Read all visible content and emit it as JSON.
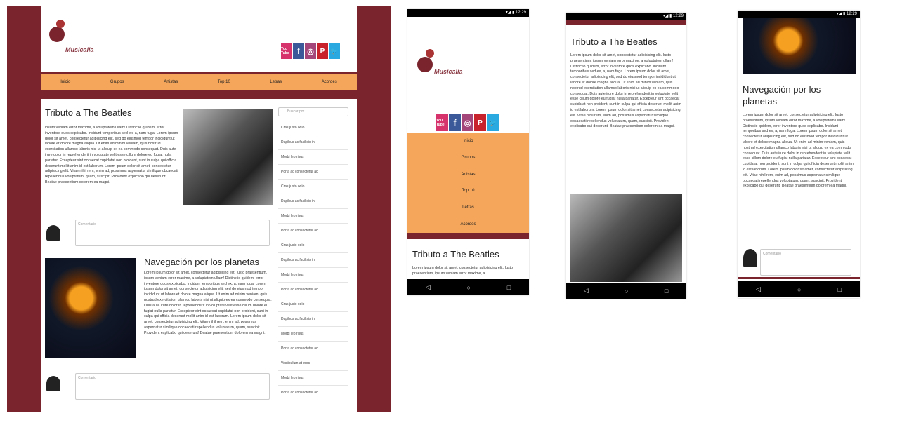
{
  "colors": {
    "brand": "#7a252e",
    "nav": "#f5a65b"
  },
  "brand": "Musicalia",
  "social": [
    {
      "icon": "youtube-icon",
      "label": "You Tube"
    },
    {
      "icon": "facebook-icon",
      "label": "f"
    },
    {
      "icon": "instagram-icon",
      "label": "◎"
    },
    {
      "icon": "pinterest-icon",
      "label": "P"
    },
    {
      "icon": "twitter-icon",
      "label": "🐦"
    }
  ],
  "nav": [
    "Inicio",
    "Grupos",
    "Artistas",
    "Top 10",
    "Letras",
    "Acordes"
  ],
  "posts": [
    {
      "title": "Tributo a The Beatles",
      "text": "ipsum veniam error maxime, a voluptatem ullam! Distinctio quidem, error inventore quos explicabo. Incidunt temporibus sed ex, a, nam fuga. Lorem ipsum dolor sit amet, consectetur adipisicing elit, sed do eiusmod tempor incididunt ut labore et dolore magna aliqua. Ut enim ad minim veniam, quis nostrud exercitation ullamco laboris nisi ut aliquip ex ea commodo consequat. Duis aute irure dolor in reprehenderit in voluptate velit esse cillum dolore eu fugiat nulla pariatur. Excepteur sint occaecat cupidatat non proident, sunt in culpa qui officia deserunt mollit anim id est laborum. Lorem ipsum dolor sit amet, consectetur adipisicing elit. Vitae nihil rem, enim ad, possimus aspernatur similique obcaecati repellendus voluptatum, quam, suscipit. Provident explicabo qui deserunt! Beatae praesentium dolorem ea magni.",
      "comment": "Comentario"
    },
    {
      "title": "Navegación por los planetas",
      "text": "Lorem ipsum dolor sit amet, consectetur adipisicing elit. Iusto praesentium, ipsum veniam error maxime, a voluptatem ullam! Distinctio quidem, error inventore quos explicabo. Incidunt temporibus sed ex, a, nam fuga. Lorem ipsum dolor sit amet, consectetur adipisicing elit, sed do eiusmod tempor incididunt ut labore et dolore magna aliqua. Ut enim ad minim veniam, quis nostrud exercitation ullamco laboris nisi ut aliquip ex ea commodo consequat. Duis aute irure dolor in reprehenderit in voluptate velit esse cillum dolore eu fugiat nulla pariatur. Excepteur sint occaecat cupidatat non proident, sunt in culpa qui officia deserunt mollit anim id est laborum. Lorem ipsum dolor sit amet, consectetur adipisicing elit. Vitae nihil rem, enim ad, possimus aspernatur similique obcaecati repellendus voluptatum, quam, suscipit. Provident explicabo qui deserunt! Beatae praesentium dolorem ea magni.",
      "comment": "Comentario"
    }
  ],
  "search_placeholder": "Buscar por...",
  "sidebar": [
    "Cras justo odio",
    "Dapibus ac facilisis in",
    "Morbi leo risus",
    "Porta ac consectetur ac",
    "Cras justo odio",
    "Dapibus ac facilisis in",
    "Morbi leo risus",
    "Porta ac consectetur ac",
    "Cras justo odio",
    "Dapibus ac facilisis in",
    "Morbi leo risus",
    "Porta ac consectetur ac",
    "Cras justo odio",
    "Dapibus ac facilisis in",
    "Morbi leo risus",
    "Porta ac consectetur ac",
    "Vestibulum at eros",
    "Morbi leo risus",
    "Porta ac consectetur ac"
  ],
  "phone": {
    "time": "12:29",
    "status_icons": "▾◢ ▮",
    "nav_back": "◁",
    "nav_home": "○",
    "nav_recent": "□"
  },
  "mobile": {
    "p1_title": "Tributo a The Beatles",
    "p1_text": "Lorem ipsum dolor sit amet, consectetur adipisicing elit. Iusto praesentium, ipsum veniam error maxime, a",
    "p2_title": "Tributo a The Beatles",
    "p2_text": "Lorem ipsum dolor sit amet, consectetur adipisicing elit. Iusto praesentium, ipsum veniam error maxime, a voluptatem ullam! Distinctio quidem, error inventore quos explicabo. Incidunt temporibus sed ex, a, nam fuga. Lorem ipsum dolor sit amet, consectetur adipisicing elit, sed do eiusmod tempor incididunt ut labore et dolore magna aliqua. Ut enim ad minim veniam, quis nostrud exercitation ullamco laboris nisi ut aliquip ex ea commodo consequat. Duis aute irure dolor in reprehenderit in voluptate velit esse cillum dolore eu fugiat nulla pariatur. Excepteur sint occaecat cupidatat non proident, sunt in culpa qui officia deserunt mollit anim id est laborum. Lorem ipsum dolor sit amet, consectetur adipisicing elit. Vitae nihil rem, enim ad, possimus aspernatur similique obcaecati repellendus voluptatum, quam, suscipit. Provident explicabo qui deserunt! Beatae praesentium dolorem ea magni.",
    "p3_title": "Navegación por los planetas",
    "p3_text": "Lorem ipsum dolor sit amet, consectetur adipisicing elit. Iusto praesentium, ipsum veniam error maxime, a voluptatem ullam! Distinctio quidem, error inventore quos explicabo. Incidunt temporibus sed ex, a, nam fuga. Lorem ipsum dolor sit amet, consectetur adipisicing elit, sed do eiusmod tempor incididunt ut labore et dolore magna aliqua. Ut enim ad minim veniam, quis nostrud exercitation ullamco laboris nisi ut aliquip ex ea commodo consequat. Duis aute irure dolor in reprehenderit in voluptate velit esse cillum dolore eu fugiat nulla pariatur. Excepteur sint occaecat cupidatat non proident, sunt in culpa qui officia deserunt mollit anim id est laborum. Lorem ipsum dolor sit amet, consectetur adipisicing elit. Vitae nihil rem, enim ad, possimus aspernatur similique obcaecati repellendus voluptatum, quam, suscipit. Provident explicabo qui deserunt! Beatae praesentium dolorem ea magni.",
    "comment": "Comentario"
  }
}
